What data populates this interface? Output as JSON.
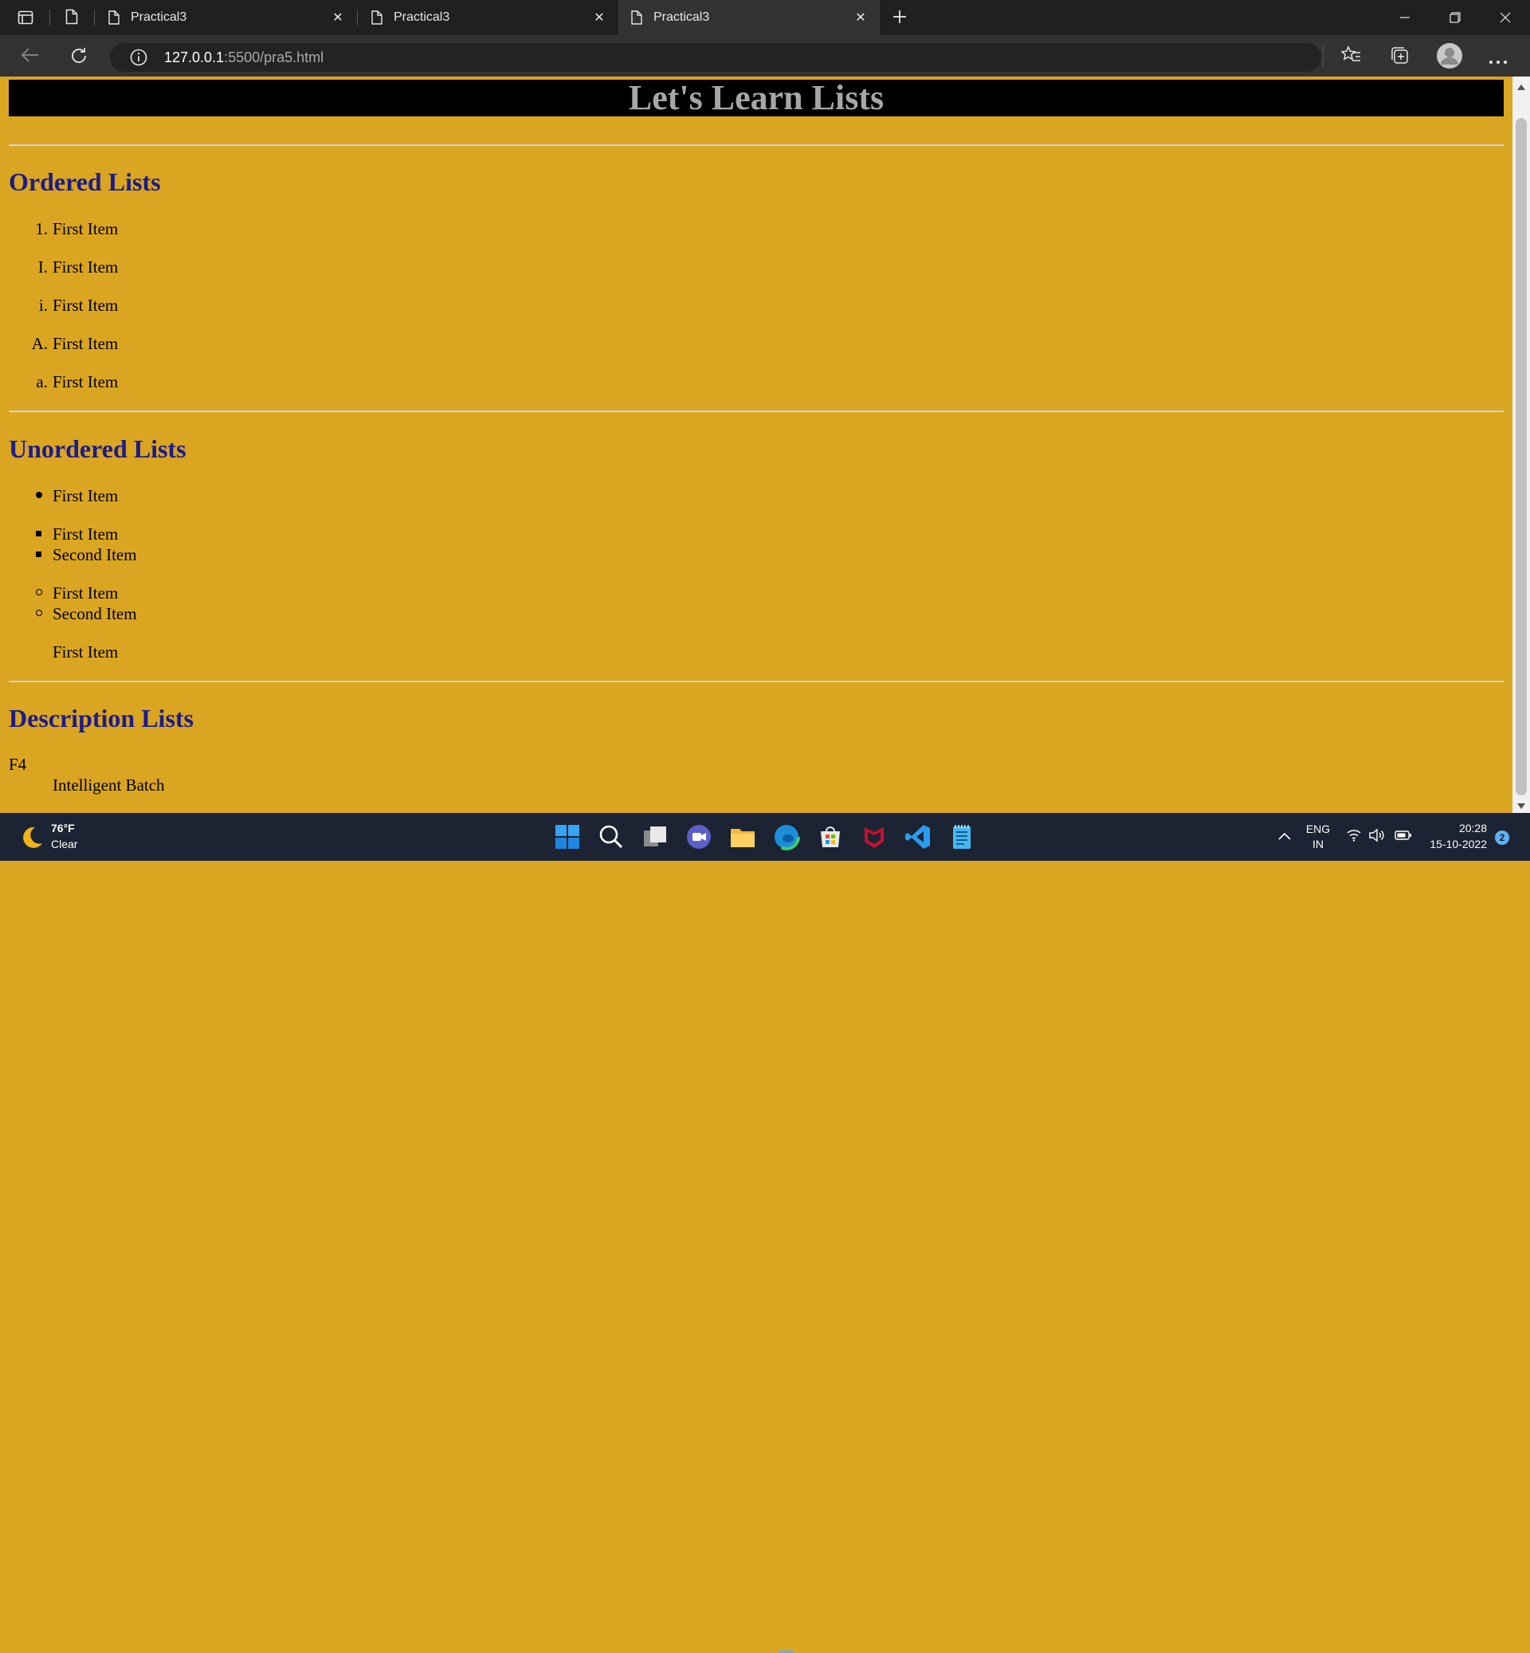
{
  "browser": {
    "tabs": [
      {
        "title": "Practical3"
      },
      {
        "title": "Practical3"
      },
      {
        "title": "Practical3"
      }
    ],
    "url_host": "127.0.0.1",
    "url_path": ":5500/pra5.html"
  },
  "page": {
    "banner": "Let's Learn Lists",
    "ordered": {
      "heading": "Ordered Lists",
      "items": [
        {
          "marker": "1.",
          "text": "First Item"
        },
        {
          "marker": "I.",
          "text": "First Item"
        },
        {
          "marker": "i.",
          "text": "First Item"
        },
        {
          "marker": "A.",
          "text": "First Item"
        },
        {
          "marker": "a.",
          "text": "First Item"
        }
      ]
    },
    "unordered": {
      "heading": "Unordered Lists",
      "disc": [
        "First Item"
      ],
      "square": [
        "First Item",
        "Second Item"
      ],
      "circle": [
        "First Item",
        "Second Item"
      ],
      "none": [
        "First Item"
      ]
    },
    "description": {
      "heading": "Description Lists",
      "term": "F4",
      "definition": "Intelligent Batch"
    }
  },
  "taskbar": {
    "weather_temp": "76°F",
    "weather_desc": "Clear",
    "lang_top": "ENG",
    "lang_bottom": "IN",
    "time": "20:28",
    "date": "15-10-2022",
    "notification_count": "2"
  }
}
